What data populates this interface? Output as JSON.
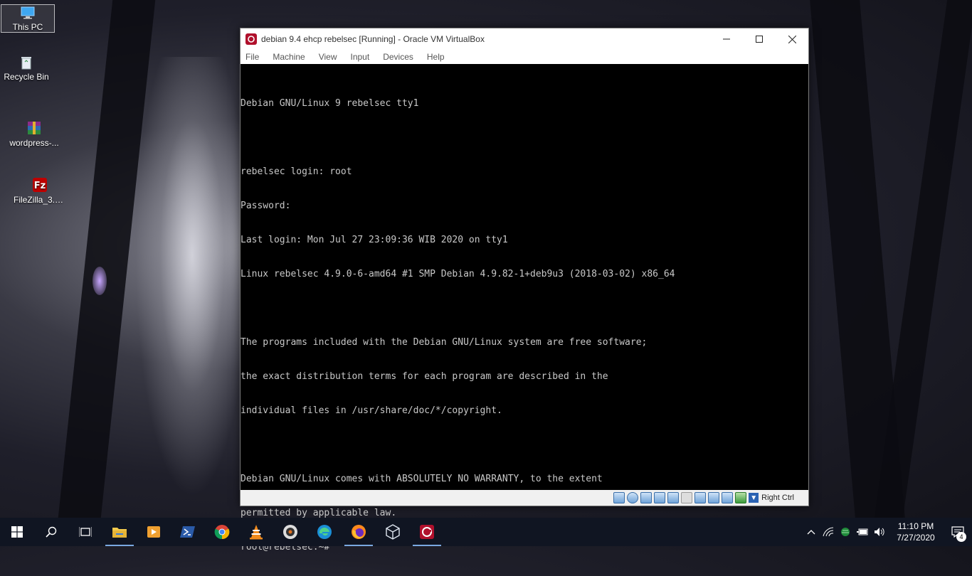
{
  "desktop": {
    "icons": [
      {
        "label": "This PC"
      },
      {
        "label": "Recycle Bin"
      },
      {
        "label": "wordpress-..."
      },
      {
        "label": "FileZilla_3.4..."
      }
    ]
  },
  "window": {
    "title": "debian 9.4 ehcp rebelsec [Running] - Oracle VM VirtualBox",
    "menu": [
      "File",
      "Machine",
      "View",
      "Input",
      "Devices",
      "Help"
    ],
    "terminal": {
      "lines": [
        "Debian GNU/Linux 9 rebelsec tty1",
        "",
        "rebelsec login: root",
        "Password:",
        "Last login: Mon Jul 27 23:09:36 WIB 2020 on tty1",
        "Linux rebelsec 4.9.0-6-amd64 #1 SMP Debian 4.9.82-1+deb9u3 (2018-03-02) x86_64",
        "",
        "The programs included with the Debian GNU/Linux system are free software;",
        "the exact distribution terms for each program are described in the",
        "individual files in /usr/share/doc/*/copyright.",
        "",
        "Debian GNU/Linux comes with ABSOLUTELY NO WARRANTY, to the extent",
        "permitted by applicable law.",
        "root@rebelsec:~#"
      ]
    },
    "status": {
      "host_key": "Right Ctrl"
    }
  },
  "taskbar": {
    "clock_time": "11:10 PM",
    "clock_date": "7/27/2020",
    "notification_count": "4"
  },
  "colors": {
    "taskbar": "#101522",
    "accent": "#7aa8e0",
    "vbox_red": "#b0102c"
  }
}
